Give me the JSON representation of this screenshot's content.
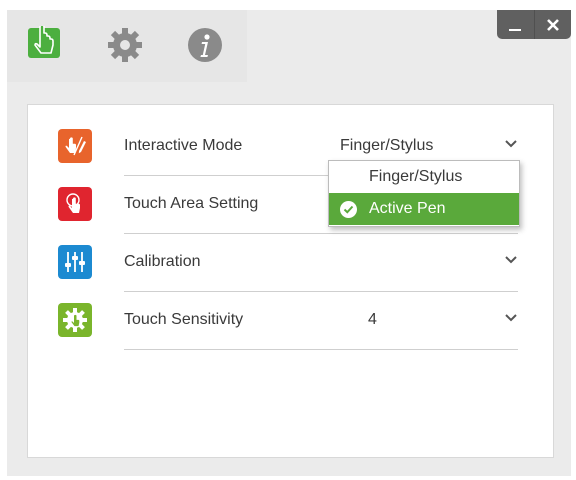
{
  "toolbar": {
    "icons": [
      "touch-mode-icon",
      "gear-icon",
      "info-icon"
    ],
    "window_controls": [
      "minimize-icon",
      "close-icon"
    ]
  },
  "settings": [
    {
      "label": "Interactive Mode",
      "value": "Finger/Stylus",
      "icon": "interactive-mode-icon",
      "color": "#e8642c"
    },
    {
      "label": "Touch Area Setting",
      "value": "",
      "icon": "touch-area-icon",
      "color": "#e0252f"
    },
    {
      "label": "Calibration",
      "value": "",
      "icon": "calibration-sliders-icon",
      "color": "#1c8ad1"
    },
    {
      "label": "Touch Sensitivity",
      "value": "4",
      "icon": "touch-sensitivity-icon",
      "color": "#7ab52b"
    }
  ],
  "dropdown": {
    "options": [
      "Finger/Stylus",
      "Active Pen"
    ],
    "selected": "Active Pen",
    "selected_color": "#5aa93b"
  },
  "colors": {
    "accent_green": "#4caf3f",
    "icon_gray": "#8a8a8a"
  }
}
